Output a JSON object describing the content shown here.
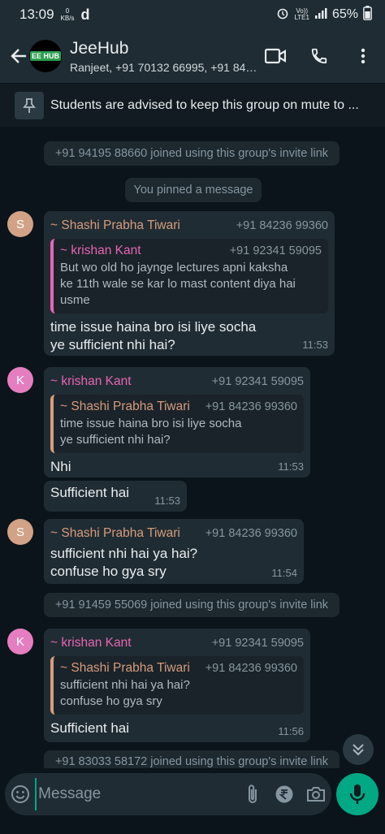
{
  "status": {
    "time": "13:09",
    "kbs_value": "0",
    "kbs_unit": "KB/s",
    "app_letter": "d",
    "volte_top": "Vo))",
    "volte_bottom": "LTE1",
    "battery": "65%"
  },
  "header": {
    "title": "JeeHub",
    "subtitle": "Ranjeet, +91 70132 66995, +91 84…",
    "logo_text": "EE HUB"
  },
  "pinned": {
    "text": "Students are advised to keep this group on mute to ..."
  },
  "messages": [
    {
      "type": "system",
      "text": "+91 94195 88660 joined using this group's invite link"
    },
    {
      "type": "system",
      "text": "You pinned a message"
    },
    {
      "avatar": "S",
      "sender": "~ Shashi Prabha Tiwari",
      "phone": "+91 84236 99360",
      "quote": {
        "sender": "~ krishan Kant",
        "phone": "+91 92341 59095",
        "lines": [
          "But wo old ho jaynge lectures apni kaksha",
          "ke 11th wale se kar lo mast content diya hai",
          "usme"
        ]
      },
      "lines": [
        "time issue haina bro isi liye socha",
        "ye sufficient nhi hai?"
      ],
      "time": "11:53"
    },
    {
      "avatar": "K",
      "sender": "~ krishan Kant",
      "phone": "+91 92341 59095",
      "quote": {
        "sender": "~ Shashi Prabha Tiwari",
        "phone": "+91 84236 99360",
        "lines": [
          "time issue haina bro isi liye socha",
          "ye sufficient nhi hai?"
        ]
      },
      "lines": [
        "Nhi"
      ],
      "time": "11:53"
    },
    {
      "lines": [
        "Sufficient hai"
      ],
      "time": "11:53"
    },
    {
      "avatar": "S",
      "sender": "~ Shashi Prabha Tiwari",
      "phone": "+91 84236 99360",
      "lines": [
        "sufficient nhi hai ya hai?",
        "confuse ho gya sry"
      ],
      "time": "11:54"
    },
    {
      "type": "system",
      "text": "+91 91459 55069 joined using this group's invite link"
    },
    {
      "avatar": "K",
      "sender": "~ krishan Kant",
      "phone": "+91 92341 59095",
      "quote": {
        "sender": "~ Shashi Prabha Tiwari",
        "phone": "+91 84236 99360",
        "lines": [
          "sufficient nhi hai ya hai?",
          "confuse ho gya sry"
        ]
      },
      "lines": [
        "Sufficient hai"
      ],
      "time": "11:56"
    },
    {
      "type": "system",
      "text": "+91 83033 58172 joined using this group's invite link"
    }
  ],
  "input": {
    "placeholder": "Message"
  },
  "colors": {
    "shashi": "#d69c7e",
    "krishan": "#e765b5",
    "accent": "#00a884",
    "avatar_s": "#d1a286",
    "avatar_k": "#e57ec0"
  }
}
